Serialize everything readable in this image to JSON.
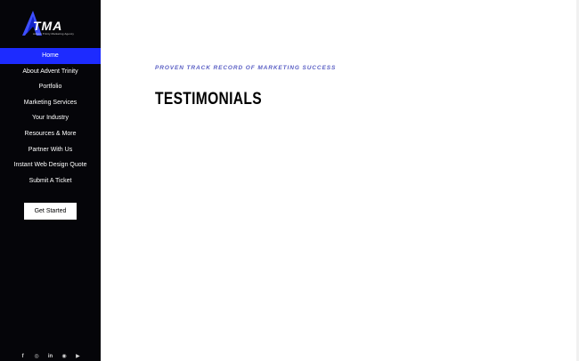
{
  "brand": {
    "name": "TMA",
    "tagline": "Advent Trinity Marketing Agency",
    "accent": "#1d2bff"
  },
  "sidebar": {
    "items": [
      {
        "label": "Home",
        "active": true
      },
      {
        "label": "About Advent Trinity"
      },
      {
        "label": "Portfolio"
      },
      {
        "label": "Marketing Services"
      },
      {
        "label": "Your Industry"
      },
      {
        "label": "Resources & More"
      },
      {
        "label": "Partner With Us"
      },
      {
        "label": "Instant Web Design Quote"
      },
      {
        "label": "Submit A Ticket"
      }
    ],
    "cta_label": "Get Started",
    "social": [
      {
        "icon": "facebook-icon",
        "glyph": "f"
      },
      {
        "icon": "instagram-icon",
        "glyph": "◎"
      },
      {
        "icon": "linkedin-icon",
        "glyph": "in"
      },
      {
        "icon": "spotify-icon",
        "glyph": "◉"
      },
      {
        "icon": "youtube-icon",
        "glyph": "▶"
      }
    ]
  },
  "main": {
    "eyebrow": "PROVEN TRACK RECORD OF MARKETING SUCCESS",
    "title": "TESTIMONIALS"
  }
}
